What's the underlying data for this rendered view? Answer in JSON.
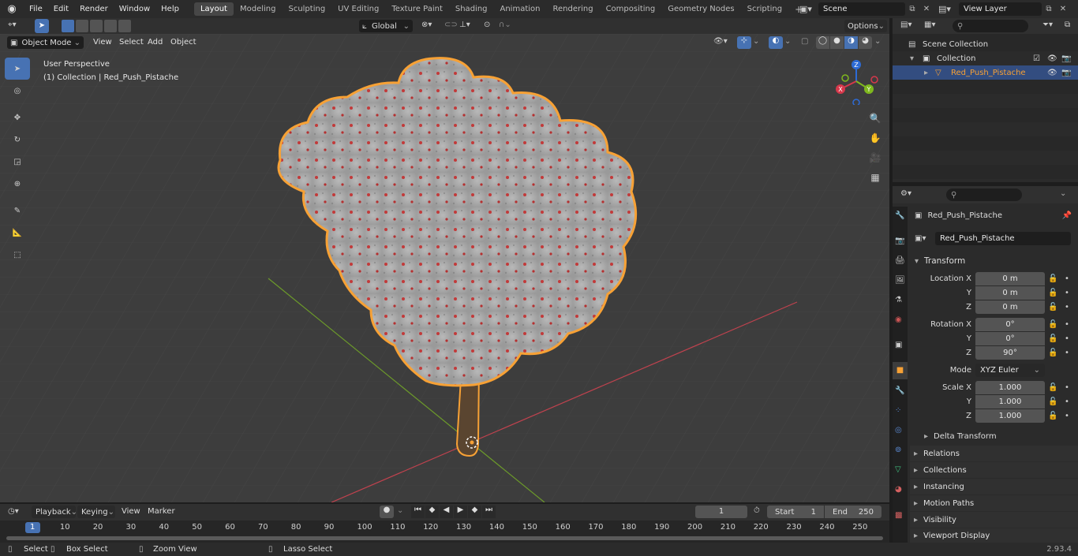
{
  "topbar": {
    "menus": [
      "File",
      "Edit",
      "Render",
      "Window",
      "Help"
    ],
    "workspaces": [
      "Layout",
      "Modeling",
      "Sculpting",
      "UV Editing",
      "Texture Paint",
      "Shading",
      "Animation",
      "Rendering",
      "Compositing",
      "Geometry Nodes",
      "Scripting"
    ],
    "active_workspace": "Layout",
    "add_workspace": "+",
    "scene": "Scene",
    "view_layer": "View Layer"
  },
  "viewport_header": {
    "mode": "Object Mode",
    "menus": [
      "View",
      "Select",
      "Add",
      "Object"
    ],
    "transform_orientation": "Global",
    "options": "Options"
  },
  "viewport": {
    "perspective_label": "User Perspective",
    "collection_label": "(1) Collection | Red_Push_Pistache",
    "gizmo": {
      "x": "X",
      "y": "Y",
      "z": "Z"
    }
  },
  "outliner": {
    "scene_collection": "Scene Collection",
    "collection": "Collection",
    "object": "Red_Push_Pistache"
  },
  "properties": {
    "object_name": "Red_Push_Pistache",
    "data_name": "Red_Push_Pistache",
    "transform_title": "Transform",
    "location": {
      "label": "Location X",
      "x": "0 m",
      "y": "0 m",
      "z": "0 m"
    },
    "rotation": {
      "label": "Rotation X",
      "x": "0°",
      "y": "0°",
      "z": "90°"
    },
    "mode_label": "Mode",
    "mode_value": "XYZ Euler",
    "scale": {
      "label": "Scale X",
      "x": "1.000",
      "y": "1.000",
      "z": "1.000"
    },
    "axis_y": "Y",
    "axis_z": "Z",
    "delta_transform": "Delta Transform",
    "sections": [
      "Relations",
      "Collections",
      "Instancing",
      "Motion Paths",
      "Visibility",
      "Viewport Display"
    ]
  },
  "timeline": {
    "menus": [
      "Playback",
      "Keying",
      "View",
      "Marker"
    ],
    "current_frame": "1",
    "start_label": "Start",
    "start_value": "1",
    "end_label": "End",
    "end_value": "250",
    "ruler": [
      "1",
      "10",
      "20",
      "30",
      "40",
      "50",
      "60",
      "70",
      "80",
      "90",
      "100",
      "110",
      "120",
      "130",
      "140",
      "150",
      "160",
      "170",
      "180",
      "190",
      "200",
      "210",
      "220",
      "230",
      "240",
      "250"
    ]
  },
  "statusbar": {
    "select": "Select",
    "box_select": "Box Select",
    "zoom_view": "Zoom View",
    "lasso_select": "Lasso Select",
    "version": "2.93.4"
  },
  "colors": {
    "accent_blue": "#4772b3",
    "selection_orange": "#f7a135",
    "axis_red": "#c0424e",
    "axis_green": "#6c9a2a"
  }
}
